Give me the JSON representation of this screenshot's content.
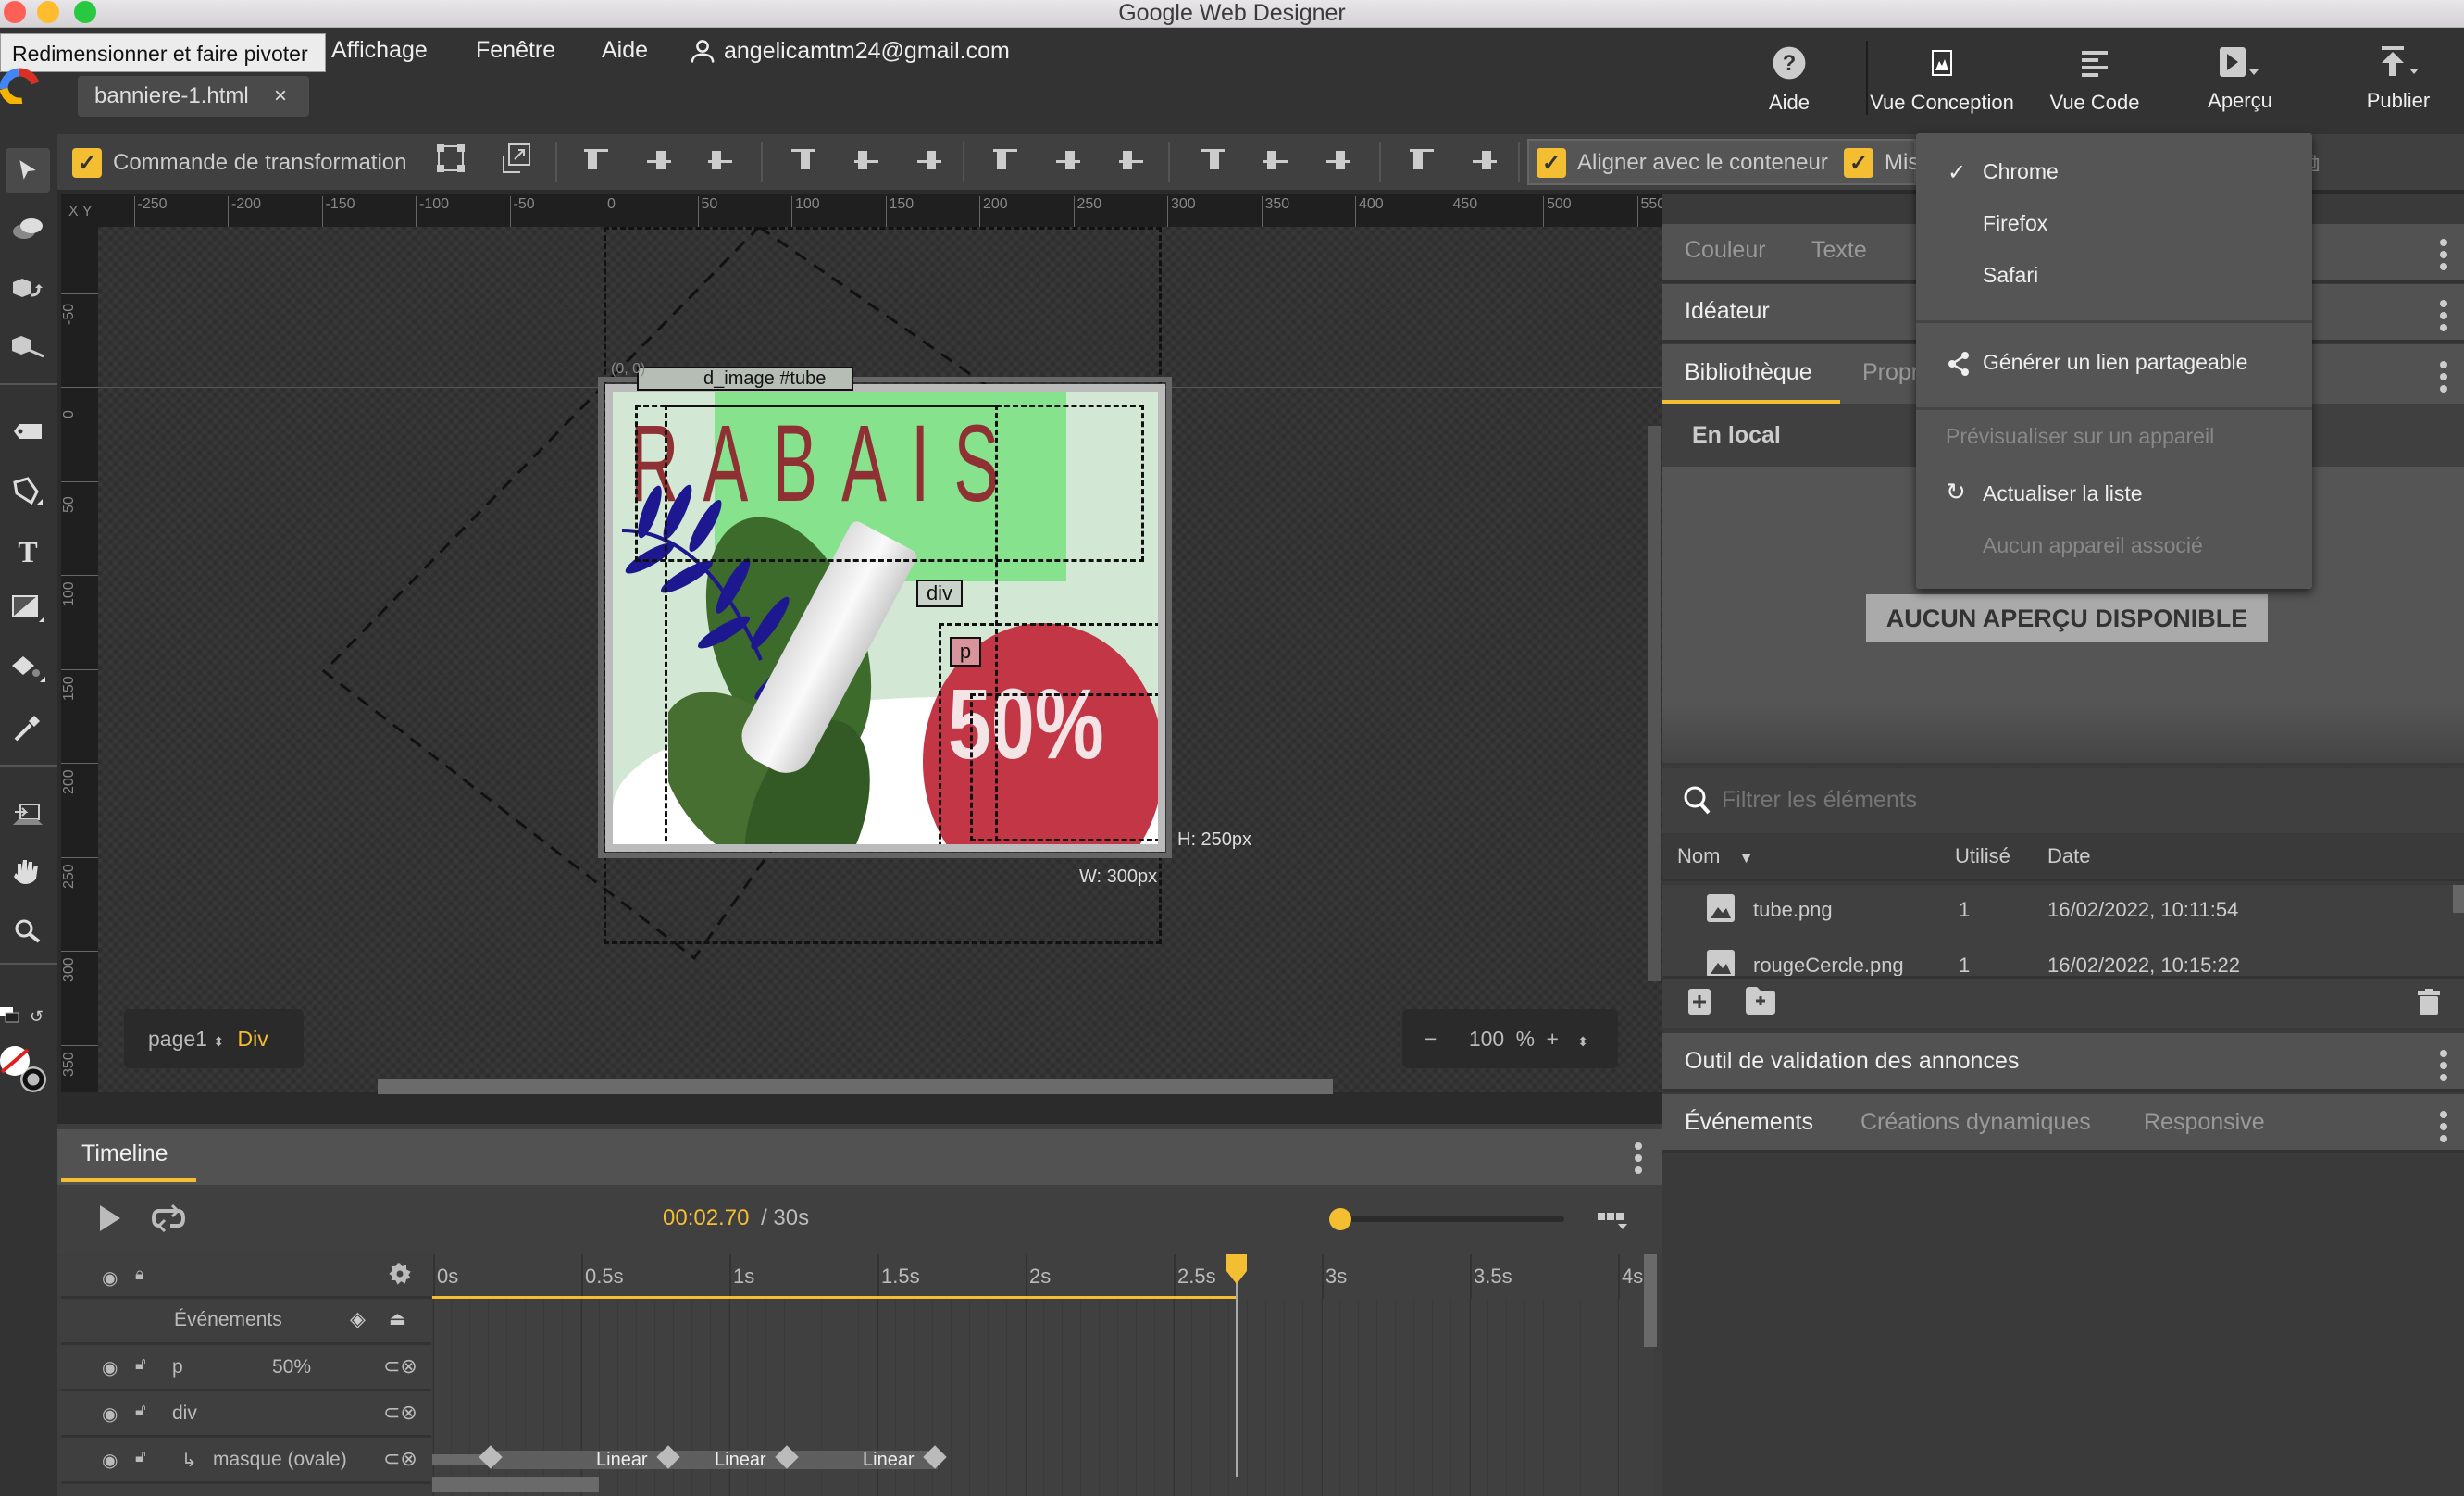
{
  "window": {
    "title": "Google Web Designer"
  },
  "menu": {
    "items": [
      "Affichage",
      "Fenêtre",
      "Aide"
    ],
    "user_email": "angelicamtm24@gmail.com",
    "tooltip": "Redimensionner et faire pivoter"
  },
  "file_tab": {
    "name": "banniere-1.html",
    "close": "×"
  },
  "top_buttons": {
    "help": "Aide",
    "design_view": "Vue Conception",
    "code_view": "Vue Code",
    "preview": "Aperçu",
    "publish": "Publier"
  },
  "toolbar": {
    "transform_control": "Commande de transformation",
    "align_container": "Aligner avec le conteneur",
    "truncated_option": "Mis"
  },
  "rulers": {
    "corner": "X Y",
    "h_ticks": [
      "-250",
      "-200",
      "-150",
      "-100",
      "-50",
      "0",
      "50",
      "100",
      "150",
      "200",
      "250",
      "300",
      "350",
      "400",
      "450",
      "500",
      "550"
    ],
    "v_ticks": [
      "-50",
      "0",
      "50",
      "100",
      "150",
      "200",
      "250",
      "300",
      "350"
    ]
  },
  "stage": {
    "origin_label": "(0, 0)",
    "element_label": "d_image #tube",
    "headline": "RABAIS",
    "discount": "50%",
    "div_tag": "div",
    "p_tag": "p",
    "height_readout": "H: 250px",
    "width_readout": "W: 300px",
    "colors": {
      "headline": "#8f3035",
      "circle": "#c23646",
      "green_band": "#86e28c",
      "bg": "#d3e8d4",
      "fern": "#1d188f",
      "leaf": "#3d6b2c"
    }
  },
  "page_nav": {
    "page": "page1",
    "element": "Div"
  },
  "zoom": {
    "minus": "−",
    "value": "100",
    "unit": "%",
    "plus": "+"
  },
  "timeline": {
    "tab": "Timeline",
    "current_time": "00:02.70",
    "duration": "/ 30s",
    "playhead_seconds": 2.7,
    "time_ticks": [
      "0s",
      "0.5s",
      "1s",
      "1.5s",
      "2s",
      "2.5s",
      "3s",
      "3.5s",
      "4s"
    ],
    "events_label": "Événements",
    "rows": [
      {
        "name": "p",
        "value": "50%"
      },
      {
        "name": "div",
        "value": ""
      },
      {
        "name": "masque (ovale)",
        "prefix": "↳",
        "value": ""
      }
    ],
    "easing_labels": [
      "Linear",
      "Linear",
      "Linear"
    ]
  },
  "right_panel": {
    "tabs_row1": [
      "Couleur",
      "Texte"
    ],
    "ideator": "Idéateur",
    "tabs_row3": [
      "Bibliothèque",
      "Propr"
    ],
    "subsection": "En local",
    "no_preview": "AUCUN APERÇU DISPONIBLE",
    "filter_placeholder": "Filtrer les éléments",
    "columns": [
      "Nom",
      "Utilisé",
      "Date"
    ],
    "files": [
      {
        "name": "tube.png",
        "used": "1",
        "date": "16/02/2022, 10:11:54"
      },
      {
        "name": "rougeCercle.png",
        "used": "1",
        "date": "16/02/2022, 10:15:22"
      }
    ],
    "ad_validator": "Outil de validation des annonces",
    "bottom_tabs": [
      "Événements",
      "Créations dynamiques",
      "Responsive"
    ]
  },
  "preview_menu": {
    "browsers": [
      "Chrome",
      "Firefox",
      "Safari"
    ],
    "selected": "Chrome",
    "share_link": "Générer un lien partageable",
    "device_preview": "Prévisualiser sur un appareil",
    "refresh_list": "Actualiser la liste",
    "no_device": "Aucun appareil associé"
  },
  "accent_color": "#f4be33"
}
